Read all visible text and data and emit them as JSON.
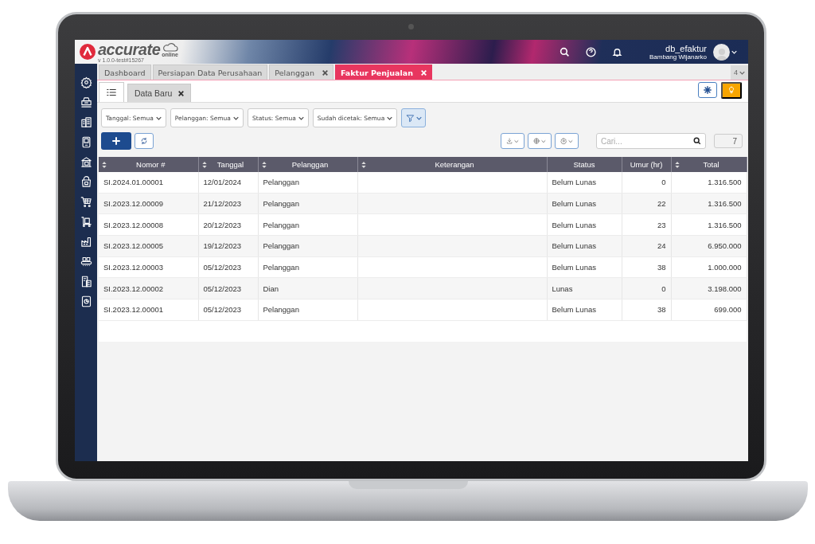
{
  "header": {
    "logo": "accurate",
    "logo_sub": "online",
    "version": "v 1.0.0-test#15267",
    "db": "db_efaktur",
    "user": "Bambang Wijanarko"
  },
  "tabs": [
    {
      "label": "Dashboard",
      "closable": false,
      "selected": false
    },
    {
      "label": "Persiapan Data Perusahaan",
      "closable": false,
      "selected": false
    },
    {
      "label": "Pelanggan",
      "closable": true,
      "selected": false
    },
    {
      "label": "Faktur Penjualan",
      "closable": true,
      "selected": true
    }
  ],
  "tab_count": "4",
  "subtabs": [
    {
      "label": "Data Baru",
      "closable": true
    }
  ],
  "filters": [
    "Tanggal: Semua",
    "Pelanggan: Semua",
    "Status: Semua",
    "Sudah dicetak: Semua"
  ],
  "search": {
    "placeholder": "Cari..."
  },
  "record_count": "7",
  "table": {
    "columns": [
      {
        "label": "Nomor #",
        "sortable": true,
        "kind": "text"
      },
      {
        "label": "Tanggal",
        "sortable": true,
        "kind": "text"
      },
      {
        "label": "Pelanggan",
        "sortable": true,
        "kind": "text"
      },
      {
        "label": "Keterangan",
        "sortable": true,
        "kind": "text"
      },
      {
        "label": "Status",
        "sortable": false,
        "kind": "text"
      },
      {
        "label": "Umur (hr)",
        "sortable": false,
        "kind": "number"
      },
      {
        "label": "Total",
        "sortable": true,
        "kind": "number"
      }
    ],
    "rows": [
      [
        "SI.2024.01.00001",
        "12/01/2024",
        "Pelanggan",
        null,
        "Belum Lunas",
        "0",
        "1.316.500"
      ],
      [
        "SI.2023.12.00009",
        "21/12/2023",
        "Pelanggan",
        null,
        "Belum Lunas",
        "22",
        "1.316.500"
      ],
      [
        "SI.2023.12.00008",
        "20/12/2023",
        "Pelanggan",
        null,
        "Belum Lunas",
        "23",
        "1.316.500"
      ],
      [
        "SI.2023.12.00005",
        "19/12/2023",
        "Pelanggan",
        null,
        "Belum Lunas",
        "24",
        "6.950.000"
      ],
      [
        "SI.2023.12.00003",
        "05/12/2023",
        "Pelanggan",
        null,
        "Belum Lunas",
        "38",
        "1.000.000"
      ],
      [
        "SI.2023.12.00002",
        "05/12/2023",
        "Dian",
        null,
        "Lunas",
        "0",
        "3.198.000"
      ],
      [
        "SI.2023.12.00001",
        "05/12/2023",
        "Pelanggan",
        null,
        "Belum Lunas",
        "38",
        "699.000"
      ]
    ]
  }
}
